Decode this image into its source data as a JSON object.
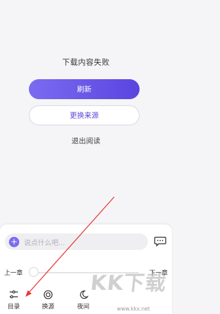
{
  "message": {
    "status": "下载内容失败",
    "refresh_label": "刷新",
    "change_source_label": "更换来源",
    "exit_label": "退出阅读"
  },
  "comment": {
    "plus_symbol": "+",
    "placeholder": "说点什么吧..."
  },
  "chapter": {
    "prev_label": "上一章",
    "next_label": "下一章",
    "progress": 0
  },
  "nav": {
    "items": [
      {
        "label": "目录",
        "icon": "toc-icon"
      },
      {
        "label": "换源",
        "icon": "source-icon"
      },
      {
        "label": "夜间",
        "icon": "moon-icon"
      }
    ]
  },
  "watermark": {
    "logo_text": "KK下载",
    "url": "www.kkx.net"
  },
  "colors": {
    "accent": "#6a57e8",
    "annotation_arrow": "#e53935"
  }
}
